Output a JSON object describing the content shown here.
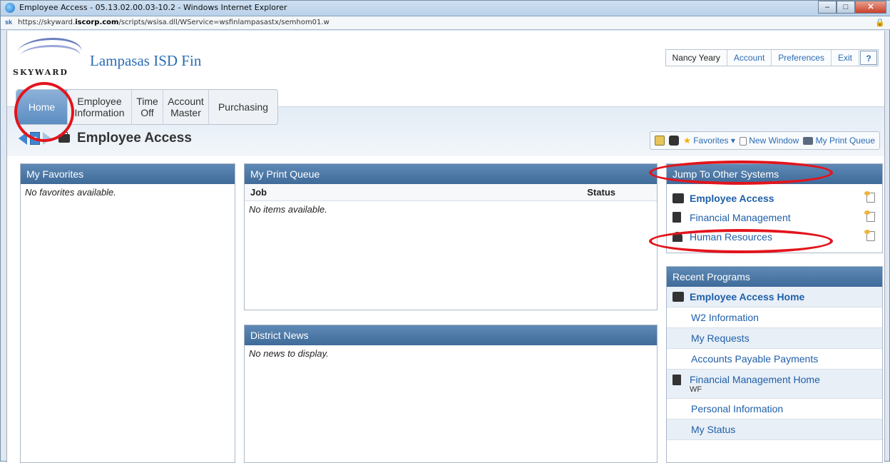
{
  "window": {
    "title": "Employee Access - 05.13.02.00.03-10.2 - Windows Internet Explorer",
    "url_prefix": "https://skyward.",
    "url_host": "iscorp.com",
    "url_rest": "/scripts/wsisa.dll/WService=wsfinlampasastx/semhom01.w"
  },
  "header": {
    "district": "Lampasas ISD Fin",
    "logo_text": "SKYWARD",
    "user": "Nancy Yeary",
    "links": [
      "Account",
      "Preferences",
      "Exit"
    ],
    "help": "?"
  },
  "nav": {
    "items": [
      {
        "label": "Home"
      },
      {
        "label": "Employee Information"
      },
      {
        "label": "Time Off"
      },
      {
        "label": "Account Master"
      },
      {
        "label": "Purchasing"
      }
    ]
  },
  "page": {
    "title": "Employee Access"
  },
  "toolbar": {
    "favorites": "Favorites",
    "new_window": "New Window",
    "print_queue": "My Print Queue"
  },
  "favorites": {
    "title": "My Favorites",
    "empty": "No favorites available."
  },
  "print_queue": {
    "title": "My Print Queue",
    "col_job": "Job",
    "col_status": "Status",
    "empty": "No items available."
  },
  "news": {
    "title": "District News",
    "empty": "No news to display."
  },
  "jump": {
    "title": "Jump To Other Systems",
    "items": [
      {
        "label": "Employee Access",
        "icon": "briefcase-icon"
      },
      {
        "label": "Financial Management",
        "icon": "calculator-icon"
      },
      {
        "label": "Human Resources",
        "icon": "person-icon"
      }
    ]
  },
  "recent": {
    "title": "Recent Programs",
    "items": [
      {
        "label": "Employee Access Home"
      },
      {
        "label": "W2 Information"
      },
      {
        "label": "My Requests"
      },
      {
        "label": "Accounts Payable Payments"
      },
      {
        "label": "Financial Management Home",
        "sub": "WF"
      },
      {
        "label": "Personal Information"
      },
      {
        "label": "My Status"
      }
    ]
  },
  "colors": {
    "header_blue": "#3f6b9a",
    "link": "#1f5fa8",
    "annotation": "#e3141c"
  }
}
